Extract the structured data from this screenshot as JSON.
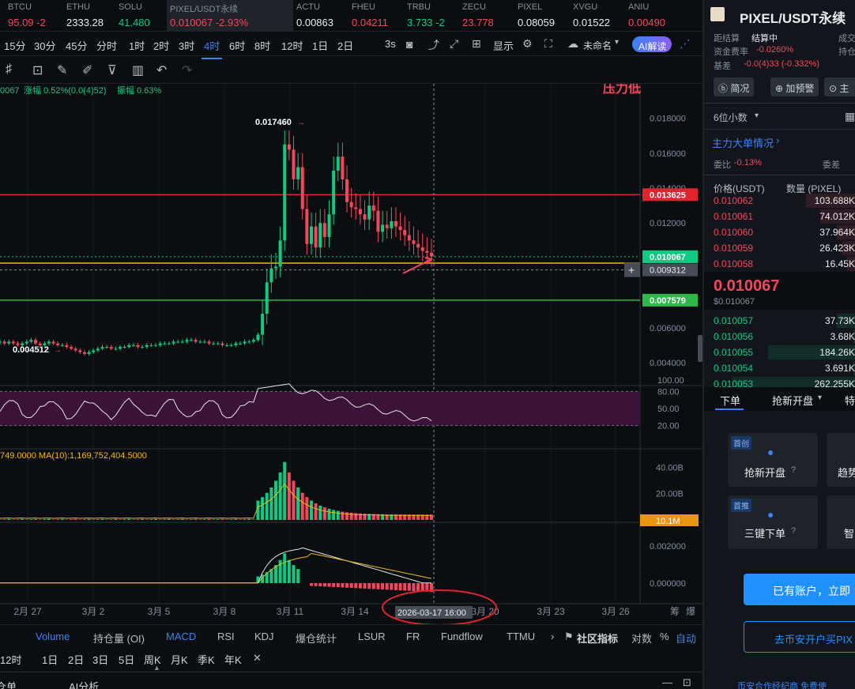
{
  "ticker": [
    {
      "name": "BTCU",
      "price": "95.09 -2",
      "color": "#f6465d"
    },
    {
      "name": "ETHU",
      "price": "2333.28",
      "color": "#eaecef"
    },
    {
      "name": "SOLU",
      "price": "41.480",
      "color": "#0ecb81"
    },
    {
      "name": "PIXEL/USDT永续",
      "price": "0.010067 -2.93%",
      "color": "#f6465d"
    },
    {
      "name": "ACTU",
      "price": "0.00863",
      "color": "#eaecef"
    },
    {
      "name": "FHEU",
      "price": "0.04211",
      "color": "#f6465d"
    },
    {
      "name": "TRBU",
      "price": "3.733 -2",
      "color": "#0ecb81"
    },
    {
      "name": "ZECU",
      "price": "23.778",
      "color": "#f6465d"
    },
    {
      "name": "PIXEL",
      "price": "0.08059",
      "color": "#eaecef"
    },
    {
      "name": "XVGU",
      "price": "0.01522",
      "color": "#eaecef"
    },
    {
      "name": "ANIU",
      "price": "0.00490",
      "color": "#f6465d"
    }
  ],
  "timeframes": [
    "15分",
    "30分",
    "45分",
    "分时",
    "1时",
    "2时",
    "3时",
    "4时",
    "6时",
    "8时",
    "12时",
    "1日",
    "2日"
  ],
  "active_timeframe": "4时",
  "toolbar": {
    "interval": "3s",
    "display": "显示",
    "layout_name": "未命名",
    "ai_button": "AI解读"
  },
  "stats": {
    "close": "0067",
    "change_label": "涨幅 0.52%(0.0(4)52)",
    "amplitude": "振幅 0.63%",
    "watermark": "压力低"
  },
  "annotations": {
    "high": "0.017460",
    "low": "0.004512"
  },
  "price_tags": {
    "resistance": "0.013625",
    "current": "0.010067",
    "crosshair": "0.009312",
    "support": "0.007579"
  },
  "ma_volume_label": "749.0000  MA(10):1,169,752,404.5000",
  "volume_tag": "10.1M",
  "crosshair_date": "2026-03-17 16:00",
  "x_dates": [
    "2月 27",
    "3月 2",
    "3月 5",
    "3月 8",
    "3月 11",
    "3月 14",
    "3月 20",
    "3月 23",
    "3月 26"
  ],
  "x_right_labels": [
    "筹",
    "爆"
  ],
  "indicator_tabs": [
    "Volume",
    "持仓量 (OI)",
    "MACD",
    "RSI",
    "KDJ",
    "爆仓统计",
    "LSUR",
    "FR",
    "Fundflow",
    "TTMU"
  ],
  "indicator_tabs_right": [
    "社区指标",
    "对数",
    "%",
    "自动"
  ],
  "timeframes2": [
    "12时",
    "1日",
    "2日",
    "3日",
    "5日",
    "周K",
    "月K",
    "季K",
    "年K"
  ],
  "bottom_tabs": [
    "仓单",
    "AI分析"
  ],
  "chart_data": {
    "type": "candlestick",
    "price_axis": {
      "ticks": [
        "0.018000",
        "0.016000",
        "0.014000",
        "0.012000",
        "0.006000",
        "0.004000"
      ],
      "range": [
        0.0035,
        0.0188
      ]
    },
    "rsi_axis": {
      "ticks": [
        "100.00",
        "80.00",
        "50.00",
        "20.00"
      ]
    },
    "volume_axis": {
      "ticks": [
        "40.00B",
        "20.00B"
      ]
    },
    "macd_axis": {
      "ticks": [
        "0.002000",
        "0.000000"
      ]
    },
    "candles_close": [
      0.0052,
      0.0051,
      0.0052,
      0.0051,
      0.005,
      0.0051,
      0.0052,
      0.0053,
      0.0051,
      0.005,
      0.0051,
      0.0052,
      0.0051,
      0.005,
      0.005,
      0.0049,
      0.0048,
      0.0047,
      0.0046,
      0.0045,
      0.0046,
      0.0047,
      0.0048,
      0.0049,
      0.0049,
      0.0048,
      0.0048,
      0.0049,
      0.0049,
      0.005,
      0.005,
      0.0049,
      0.0049,
      0.005,
      0.005,
      0.005,
      0.0051,
      0.0051,
      0.0051,
      0.0052,
      0.0052,
      0.0052,
      0.0053,
      0.0053,
      0.0052,
      0.0052,
      0.0052,
      0.0051,
      0.0051,
      0.0051,
      0.005,
      0.005,
      0.005,
      0.0051,
      0.0051,
      0.0052,
      0.0052,
      0.0053,
      0.0056,
      0.0068,
      0.0086,
      0.0094,
      0.0095,
      0.011,
      0.0165,
      0.0162,
      0.0145,
      0.0152,
      0.0128,
      0.0108,
      0.0118,
      0.0106,
      0.012,
      0.0112,
      0.0125,
      0.015,
      0.0158,
      0.0145,
      0.0132,
      0.0129,
      0.0128,
      0.0125,
      0.0122,
      0.013,
      0.0127,
      0.0115,
      0.0119,
      0.0117,
      0.0121,
      0.0118,
      0.0116,
      0.0113,
      0.011,
      0.0108,
      0.0106,
      0.0104,
      0.0103,
      0.0101
    ]
  },
  "right": {
    "symbol": "PIXEL/USDT永续",
    "settle_label": "距结算",
    "settle_value": "结算中",
    "funding_label": "资金费率",
    "funding_value": "-0.0260%",
    "basis_label": "基差",
    "basis_value": "-0.0(4)33 (-0.332%)",
    "trade_label": "成交",
    "hold_label": "持仓",
    "chips": [
      "简况",
      "加预警",
      "主"
    ],
    "precision": "6位小数",
    "main_orders": "主力大单情况",
    "ratio_label": "委比",
    "ratio_value": "-0.13%",
    "diff_label": "委差",
    "ob_header_price": "价格(USDT)",
    "ob_header_qty": "数量 (PIXEL)",
    "asks": [
      {
        "price": "0.010062",
        "qty": "103.688K"
      },
      {
        "price": "0.010061",
        "qty": "74.012K"
      },
      {
        "price": "0.010060",
        "qty": "37.964K"
      },
      {
        "price": "0.010059",
        "qty": "26.423K"
      },
      {
        "price": "0.010058",
        "qty": "16.45K"
      }
    ],
    "last_price": "0.010067",
    "last_usd": "$0.010067",
    "bids": [
      {
        "price": "0.010057",
        "qty": "37.73K"
      },
      {
        "price": "0.010056",
        "qty": "3.68K"
      },
      {
        "price": "0.010055",
        "qty": "184.26K"
      },
      {
        "price": "0.010054",
        "qty": "3.691K"
      },
      {
        "price": "0.010053",
        "qty": "262.255K"
      }
    ],
    "order_tabs": [
      "下单",
      "抢新开盘",
      "特"
    ],
    "cards": [
      {
        "badge": "首创",
        "label": "抢新开盘"
      },
      {
        "badge": "",
        "label": "趋势"
      },
      {
        "badge": "首推",
        "label": "三键下单"
      },
      {
        "badge": "",
        "label": "智"
      }
    ],
    "login_button": "已有账户，立即",
    "register_button": "去币安开户买PIX",
    "footer": "币安合作经纪商  免费使"
  }
}
